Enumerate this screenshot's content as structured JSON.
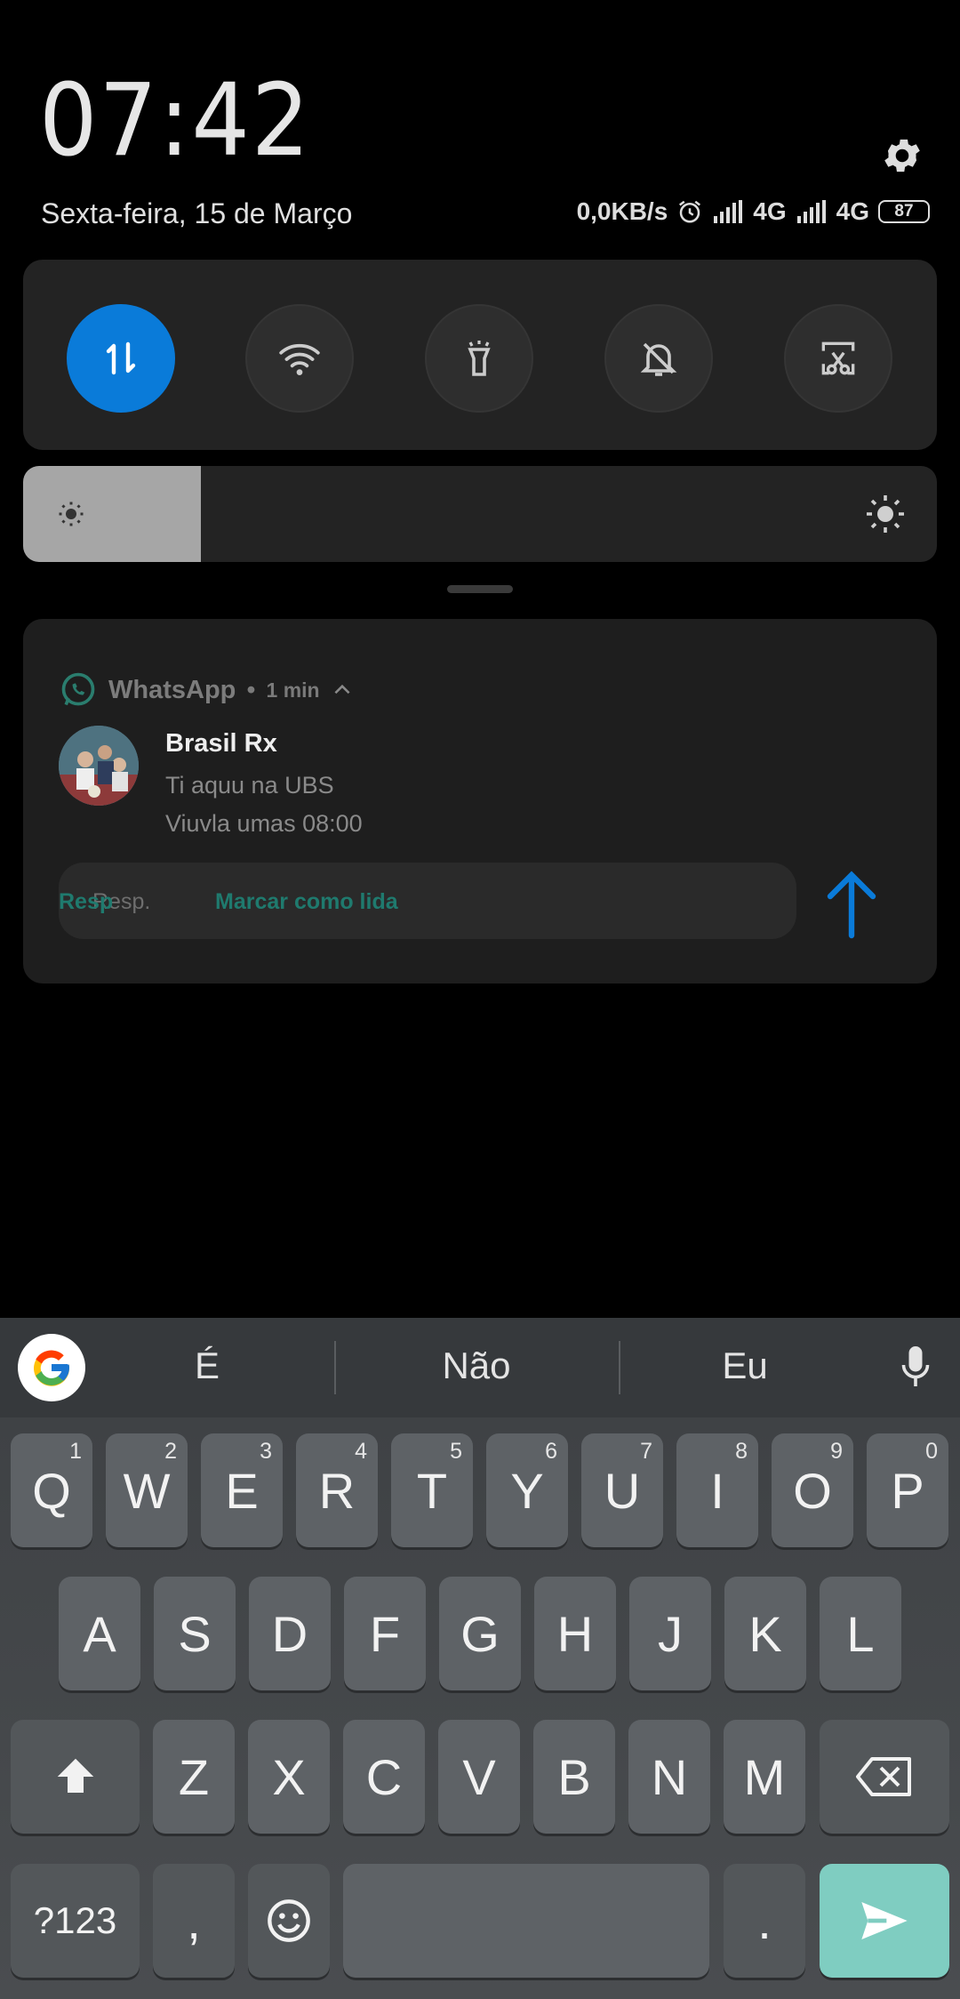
{
  "header": {
    "clock": "07:42",
    "date": "Sexta-feira, 15 de Março",
    "net_speed": "0,0KB/s",
    "net1": "4G",
    "net2": "4G",
    "battery": "87"
  },
  "quick_settings": {
    "toggles": [
      {
        "name": "mobile-data",
        "on": true
      },
      {
        "name": "wifi",
        "on": false
      },
      {
        "name": "flashlight",
        "on": false
      },
      {
        "name": "silent",
        "on": false
      },
      {
        "name": "screenshot",
        "on": false
      }
    ],
    "brightness_level": 0.195
  },
  "notification": {
    "app": "WhatsApp",
    "time": "1 min",
    "sender": "Brasil Rx",
    "lines": [
      "Ti aquu na UBS",
      "Viuvla umas 08:00"
    ],
    "reply_label": "Resp",
    "reply_placeholder": "Resp.",
    "mark_read_label": "Marcar como lida",
    "accent": "#1f7a6e"
  },
  "keyboard": {
    "suggestions": [
      "É",
      "Não",
      "Eu"
    ],
    "row1": [
      {
        "k": "Q",
        "h": "1"
      },
      {
        "k": "W",
        "h": "2"
      },
      {
        "k": "E",
        "h": "3"
      },
      {
        "k": "R",
        "h": "4"
      },
      {
        "k": "T",
        "h": "5"
      },
      {
        "k": "Y",
        "h": "6"
      },
      {
        "k": "U",
        "h": "7"
      },
      {
        "k": "I",
        "h": "8"
      },
      {
        "k": "O",
        "h": "9"
      },
      {
        "k": "P",
        "h": "0"
      }
    ],
    "row2": [
      "A",
      "S",
      "D",
      "F",
      "G",
      "H",
      "J",
      "K",
      "L"
    ],
    "row3": [
      "Z",
      "X",
      "C",
      "V",
      "B",
      "N",
      "M"
    ],
    "symbols_label": "?123",
    "comma": ",",
    "period": ".",
    "send_color": "#7fcdc1"
  }
}
